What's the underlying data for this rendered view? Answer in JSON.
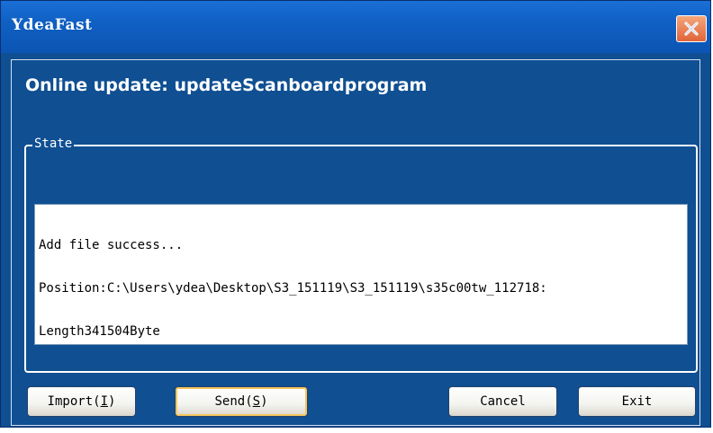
{
  "window": {
    "title": "YdeaFast",
    "close_icon": "close-icon"
  },
  "header": {
    "title": "Online update:  updateScanboardprogram"
  },
  "state_group": {
    "label": "State",
    "log_lines": [
      "Add file success...",
      "Position:C:\\Users\\ydea\\Desktop\\S3_151119\\S3_151119\\s35c00tw_112718:",
      "Length341504Byte"
    ]
  },
  "buttons": {
    "import": {
      "label": "Import",
      "mnemonic": "I"
    },
    "send": {
      "label": "Send",
      "mnemonic": "S"
    },
    "cancel": {
      "label": "Cancel"
    },
    "exit": {
      "label": "Exit"
    }
  },
  "colors": {
    "window_background": "#0f4f92",
    "titlebar": "#1060c4",
    "close_button": "#e0643a",
    "focus_highlight": "#f6c65e"
  }
}
